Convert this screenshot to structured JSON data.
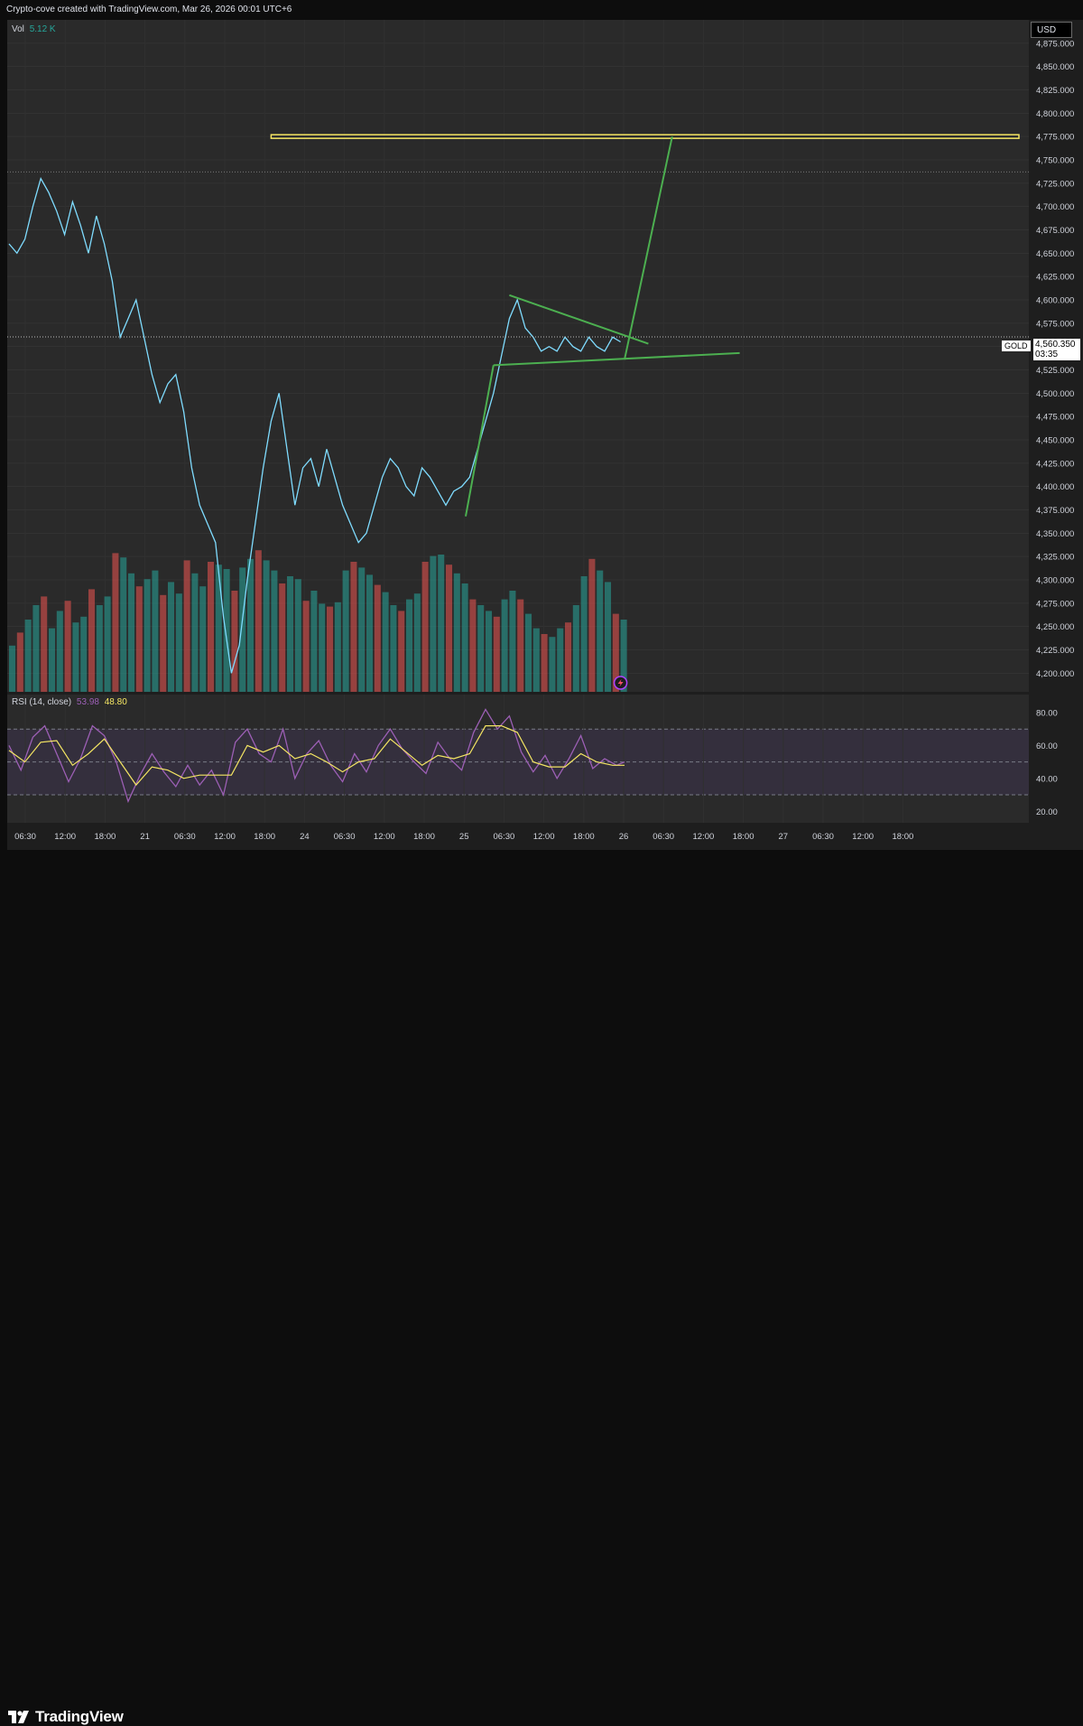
{
  "header": {
    "caption": "Crypto-cove created with TradingView.com, Mar 26, 2026 00:01 UTC+6"
  },
  "currency_label": "USD",
  "volume_legend": {
    "label": "Vol",
    "value": "5.12 K",
    "value_color": "#26a69a"
  },
  "rsi_legend": {
    "label": "RSI (14, close)",
    "rsi_value": "53.98",
    "rsi_color": "#9c5fb5",
    "ma_value": "48.80",
    "ma_color": "#f5e663"
  },
  "last_price": {
    "symbol": "GOLD",
    "value": "4,560.350",
    "countdown": "03:35"
  },
  "footer": {
    "brand": "TradingView"
  },
  "colors": {
    "price_line": "#7fdcff",
    "volume_up": "#26a69a",
    "volume_down": "#ef5350",
    "pattern": "#4caf50",
    "resistance": "#f5e663",
    "background": "#2a2a2a"
  },
  "chart_data": [
    {
      "type": "line",
      "title": "GOLD",
      "ylabel": "USD",
      "ylim": [
        4180,
        4900
      ],
      "y_ticks": [
        "4,200.000",
        "4,225.000",
        "4,250.000",
        "4,275.000",
        "4,300.000",
        "4,325.000",
        "4,350.000",
        "4,375.000",
        "4,400.000",
        "4,425.000",
        "4,450.000",
        "4,475.000",
        "4,500.000",
        "4,525.000",
        "4,550.000",
        "4,575.000",
        "4,600.000",
        "4,625.000",
        "4,650.000",
        "4,675.000",
        "4,700.000",
        "4,725.000",
        "4,750.000",
        "4,775.000",
        "4,800.000",
        "4,825.000",
        "4,850.000",
        "4,875.000"
      ],
      "x_ticks": [
        "06:30",
        "12:00",
        "18:00",
        "21",
        "06:30",
        "12:00",
        "18:00",
        "24",
        "06:30",
        "12:00",
        "18:00",
        "25",
        "06:30",
        "12:00",
        "18:00",
        "26",
        "06:30",
        "12:00",
        "18:00",
        "27",
        "06:30",
        "12:00",
        "18:00"
      ],
      "price_series": [
        [
          0,
          4660
        ],
        [
          2,
          4650
        ],
        [
          4,
          4665
        ],
        [
          6,
          4700
        ],
        [
          8,
          4730
        ],
        [
          10,
          4715
        ],
        [
          12,
          4695
        ],
        [
          14,
          4670
        ],
        [
          16,
          4705
        ],
        [
          18,
          4680
        ],
        [
          20,
          4650
        ],
        [
          22,
          4690
        ],
        [
          24,
          4660
        ],
        [
          26,
          4620
        ],
        [
          28,
          4560
        ],
        [
          30,
          4580
        ],
        [
          32,
          4600
        ],
        [
          34,
          4560
        ],
        [
          36,
          4520
        ],
        [
          38,
          4490
        ],
        [
          40,
          4510
        ],
        [
          42,
          4520
        ],
        [
          44,
          4480
        ],
        [
          46,
          4420
        ],
        [
          48,
          4380
        ],
        [
          50,
          4360
        ],
        [
          52,
          4340
        ],
        [
          54,
          4260
        ],
        [
          56,
          4200
        ],
        [
          58,
          4230
        ],
        [
          60,
          4300
        ],
        [
          62,
          4360
        ],
        [
          64,
          4420
        ],
        [
          66,
          4470
        ],
        [
          68,
          4500
        ],
        [
          70,
          4440
        ],
        [
          72,
          4380
        ],
        [
          74,
          4420
        ],
        [
          76,
          4430
        ],
        [
          78,
          4400
        ],
        [
          80,
          4440
        ],
        [
          82,
          4410
        ],
        [
          84,
          4380
        ],
        [
          86,
          4360
        ],
        [
          88,
          4340
        ],
        [
          90,
          4350
        ],
        [
          92,
          4380
        ],
        [
          94,
          4410
        ],
        [
          96,
          4430
        ],
        [
          98,
          4420
        ],
        [
          100,
          4400
        ],
        [
          102,
          4390
        ],
        [
          104,
          4420
        ],
        [
          106,
          4410
        ],
        [
          108,
          4395
        ],
        [
          110,
          4380
        ],
        [
          112,
          4395
        ],
        [
          114,
          4400
        ],
        [
          116,
          4410
        ],
        [
          118,
          4440
        ],
        [
          120,
          4470
        ],
        [
          122,
          4500
        ],
        [
          124,
          4540
        ],
        [
          126,
          4580
        ],
        [
          128,
          4600
        ],
        [
          130,
          4570
        ],
        [
          132,
          4560
        ],
        [
          134,
          4545
        ],
        [
          136,
          4550
        ],
        [
          138,
          4545
        ],
        [
          140,
          4560
        ],
        [
          142,
          4550
        ],
        [
          144,
          4545
        ],
        [
          146,
          4560
        ],
        [
          148,
          4550
        ],
        [
          150,
          4545
        ],
        [
          152,
          4560
        ],
        [
          154,
          4555
        ]
      ],
      "volume": [
        [
          0,
          3.2
        ],
        [
          2,
          4.1
        ],
        [
          4,
          5.0
        ],
        [
          6,
          6.0
        ],
        [
          8,
          6.6
        ],
        [
          10,
          4.4
        ],
        [
          12,
          5.6
        ],
        [
          14,
          6.3
        ],
        [
          16,
          4.8
        ],
        [
          18,
          5.2
        ],
        [
          20,
          7.1
        ],
        [
          22,
          6.0
        ],
        [
          24,
          6.6
        ],
        [
          26,
          9.6
        ],
        [
          28,
          9.3
        ],
        [
          30,
          8.2
        ],
        [
          32,
          7.3
        ],
        [
          34,
          7.8
        ],
        [
          36,
          8.4
        ],
        [
          38,
          6.7
        ],
        [
          40,
          7.6
        ],
        [
          42,
          6.8
        ],
        [
          44,
          9.1
        ],
        [
          46,
          8.2
        ],
        [
          48,
          7.3
        ],
        [
          50,
          9.0
        ],
        [
          52,
          8.8
        ],
        [
          54,
          8.5
        ],
        [
          56,
          7.0
        ],
        [
          58,
          8.6
        ],
        [
          60,
          9.2
        ],
        [
          62,
          9.8
        ],
        [
          64,
          9.1
        ],
        [
          66,
          8.4
        ],
        [
          68,
          7.5
        ],
        [
          70,
          8.0
        ],
        [
          72,
          7.8
        ],
        [
          74,
          6.3
        ],
        [
          76,
          7.0
        ],
        [
          78,
          6.1
        ],
        [
          80,
          5.9
        ],
        [
          82,
          6.2
        ],
        [
          84,
          8.4
        ],
        [
          86,
          9.0
        ],
        [
          88,
          8.6
        ],
        [
          90,
          8.1
        ],
        [
          92,
          7.4
        ],
        [
          94,
          6.9
        ],
        [
          96,
          6.0
        ],
        [
          98,
          5.6
        ],
        [
          100,
          6.4
        ],
        [
          102,
          6.8
        ],
        [
          104,
          9.0
        ],
        [
          106,
          9.4
        ],
        [
          108,
          9.5
        ],
        [
          110,
          8.8
        ],
        [
          112,
          8.2
        ],
        [
          114,
          7.5
        ],
        [
          116,
          6.4
        ],
        [
          118,
          6.0
        ],
        [
          120,
          5.6
        ],
        [
          122,
          5.2
        ],
        [
          124,
          6.4
        ],
        [
          126,
          7.0
        ],
        [
          128,
          6.4
        ],
        [
          130,
          5.4
        ],
        [
          132,
          4.4
        ],
        [
          134,
          4.0
        ],
        [
          136,
          3.8
        ],
        [
          138,
          4.4
        ],
        [
          140,
          4.8
        ],
        [
          142,
          6.0
        ],
        [
          144,
          8.0
        ],
        [
          146,
          9.2
        ],
        [
          148,
          8.4
        ],
        [
          150,
          7.6
        ],
        [
          152,
          5.4
        ],
        [
          154,
          5.0
        ]
      ],
      "annotations": [
        {
          "kind": "resistance-zone",
          "y": 4775
        },
        {
          "kind": "triangle-upper",
          "from": [
            126,
            4605
          ],
          "to": [
            161,
            4553
          ]
        },
        {
          "kind": "triangle-lower",
          "from": [
            122,
            4530
          ],
          "to": [
            184,
            4543
          ]
        },
        {
          "kind": "impulse-leg",
          "from": [
            115,
            4368
          ],
          "to": [
            122,
            4530
          ]
        },
        {
          "kind": "breakout-projection",
          "from": [
            155,
            4536
          ],
          "to": [
            167,
            4775
          ]
        }
      ]
    },
    {
      "type": "line",
      "title": "RSI (14, close)",
      "ylim": [
        13,
        91
      ],
      "y_ticks": [
        "80.00",
        "60.00",
        "40.00",
        "20.00"
      ],
      "bands": [
        70,
        50,
        30
      ],
      "rsi_series": [
        [
          0,
          60
        ],
        [
          3,
          45
        ],
        [
          6,
          65
        ],
        [
          9,
          72
        ],
        [
          12,
          55
        ],
        [
          15,
          38
        ],
        [
          18,
          52
        ],
        [
          21,
          72
        ],
        [
          24,
          66
        ],
        [
          27,
          50
        ],
        [
          30,
          26
        ],
        [
          33,
          42
        ],
        [
          36,
          55
        ],
        [
          39,
          44
        ],
        [
          42,
          35
        ],
        [
          45,
          48
        ],
        [
          48,
          36
        ],
        [
          51,
          45
        ],
        [
          54,
          30
        ],
        [
          57,
          62
        ],
        [
          60,
          70
        ],
        [
          63,
          55
        ],
        [
          66,
          50
        ],
        [
          69,
          70
        ],
        [
          72,
          40
        ],
        [
          75,
          55
        ],
        [
          78,
          63
        ],
        [
          81,
          48
        ],
        [
          84,
          38
        ],
        [
          87,
          55
        ],
        [
          90,
          44
        ],
        [
          93,
          60
        ],
        [
          96,
          70
        ],
        [
          99,
          58
        ],
        [
          102,
          50
        ],
        [
          105,
          43
        ],
        [
          108,
          62
        ],
        [
          111,
          52
        ],
        [
          114,
          45
        ],
        [
          117,
          68
        ],
        [
          120,
          82
        ],
        [
          123,
          70
        ],
        [
          126,
          78
        ],
        [
          129,
          56
        ],
        [
          132,
          44
        ],
        [
          135,
          54
        ],
        [
          138,
          40
        ],
        [
          141,
          52
        ],
        [
          144,
          66
        ],
        [
          147,
          46
        ],
        [
          150,
          52
        ],
        [
          153,
          48
        ],
        [
          155,
          50
        ]
      ],
      "ma_series": [
        [
          0,
          57
        ],
        [
          4,
          50
        ],
        [
          8,
          62
        ],
        [
          12,
          63
        ],
        [
          16,
          48
        ],
        [
          20,
          55
        ],
        [
          24,
          64
        ],
        [
          28,
          50
        ],
        [
          32,
          36
        ],
        [
          36,
          47
        ],
        [
          40,
          45
        ],
        [
          44,
          40
        ],
        [
          48,
          42
        ],
        [
          52,
          42
        ],
        [
          56,
          42
        ],
        [
          60,
          60
        ],
        [
          64,
          56
        ],
        [
          68,
          60
        ],
        [
          72,
          52
        ],
        [
          76,
          55
        ],
        [
          80,
          50
        ],
        [
          84,
          44
        ],
        [
          88,
          50
        ],
        [
          92,
          52
        ],
        [
          96,
          64
        ],
        [
          100,
          56
        ],
        [
          104,
          48
        ],
        [
          108,
          54
        ],
        [
          112,
          52
        ],
        [
          116,
          55
        ],
        [
          120,
          72
        ],
        [
          124,
          72
        ],
        [
          128,
          68
        ],
        [
          132,
          50
        ],
        [
          136,
          47
        ],
        [
          140,
          47
        ],
        [
          144,
          55
        ],
        [
          148,
          50
        ],
        [
          152,
          48
        ],
        [
          155,
          48
        ]
      ]
    }
  ]
}
